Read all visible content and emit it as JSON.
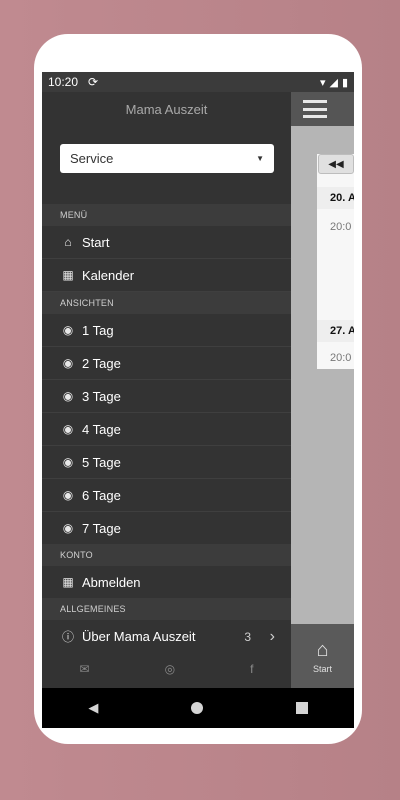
{
  "status": {
    "time": "10:20",
    "sync_icon": "sync-icon",
    "icons": [
      "wifi-icon",
      "signal-icon",
      "battery-icon"
    ]
  },
  "drawer": {
    "title": "Mama Auszeit",
    "select_value": "Service",
    "sections": {
      "menu": "MENÜ",
      "views": "ANSICHTEN",
      "account": "KONTO",
      "general": "ALLGEMEINES"
    },
    "menu_items": [
      {
        "label": "Start",
        "icon": "home-icon"
      },
      {
        "label": "Kalender",
        "icon": "calendar-icon"
      }
    ],
    "view_items": [
      {
        "label": "1 Tag",
        "icon": "eye-icon"
      },
      {
        "label": "2 Tage",
        "icon": "eye-icon"
      },
      {
        "label": "3 Tage",
        "icon": "eye-icon"
      },
      {
        "label": "4 Tage",
        "icon": "eye-icon"
      },
      {
        "label": "5 Tage",
        "icon": "eye-icon"
      },
      {
        "label": "6 Tage",
        "icon": "eye-icon"
      },
      {
        "label": "7 Tage",
        "icon": "eye-icon"
      }
    ],
    "account_items": [
      {
        "label": "Abmelden",
        "icon": "calendar-icon"
      }
    ],
    "general_items": [
      {
        "label": "Über Mama Auszeit",
        "icon": "info-icon",
        "count": "3"
      }
    ],
    "social": [
      "mail-icon",
      "instagram-icon",
      "facebook-icon"
    ]
  },
  "content": {
    "prev_label": "◀◀",
    "days": [
      {
        "header": "20. A",
        "time": "20:0"
      },
      {
        "header": "27. A",
        "time": "20:0"
      }
    ],
    "bottom_tab_label": "Start"
  }
}
